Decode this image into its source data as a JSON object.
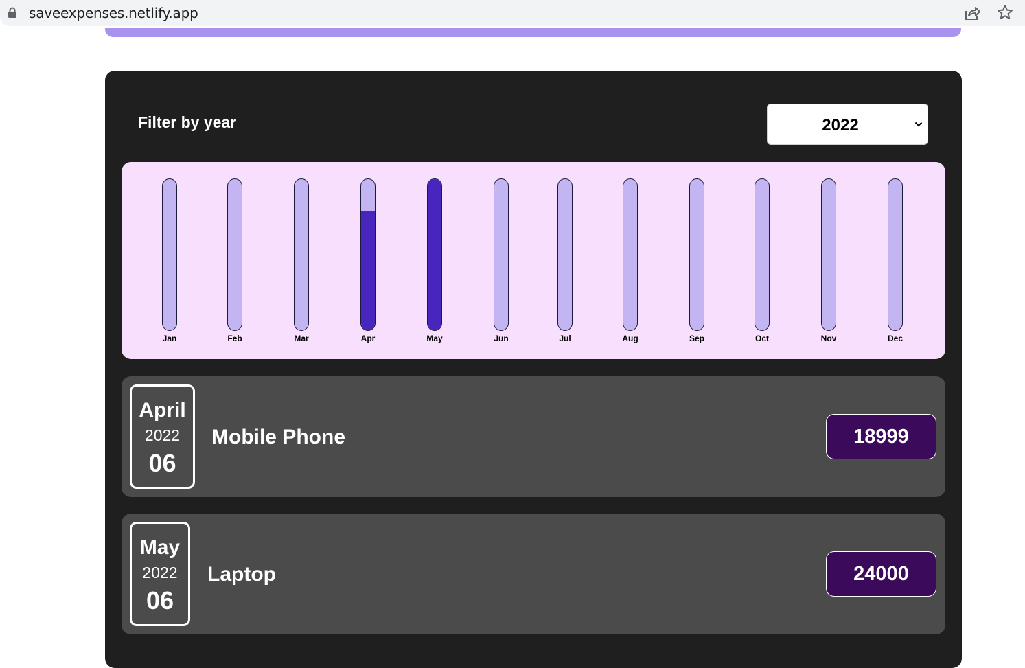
{
  "browser": {
    "url": "saveexpenses.netlify.app",
    "icons": [
      "lock-icon",
      "share-icon",
      "star-icon"
    ]
  },
  "filter": {
    "label": "Filter by year",
    "selected_year": "2022"
  },
  "chart_data": {
    "type": "bar",
    "categories": [
      "Jan",
      "Feb",
      "Mar",
      "Apr",
      "May",
      "Jun",
      "Jul",
      "Aug",
      "Sep",
      "Oct",
      "Nov",
      "Dec"
    ],
    "values": [
      0,
      0,
      0,
      18999,
      24000,
      0,
      0,
      0,
      0,
      0,
      0,
      0
    ],
    "max": 24000,
    "colors": {
      "fill": "#4826bd",
      "track": "#c3b4f2",
      "background": "#f8dffd"
    }
  },
  "expenses": [
    {
      "month": "April",
      "year": "2022",
      "day": "06",
      "title": "Mobile Phone",
      "amount": "18999"
    },
    {
      "month": "May",
      "year": "2022",
      "day": "06",
      "title": "Laptop",
      "amount": "24000"
    }
  ]
}
